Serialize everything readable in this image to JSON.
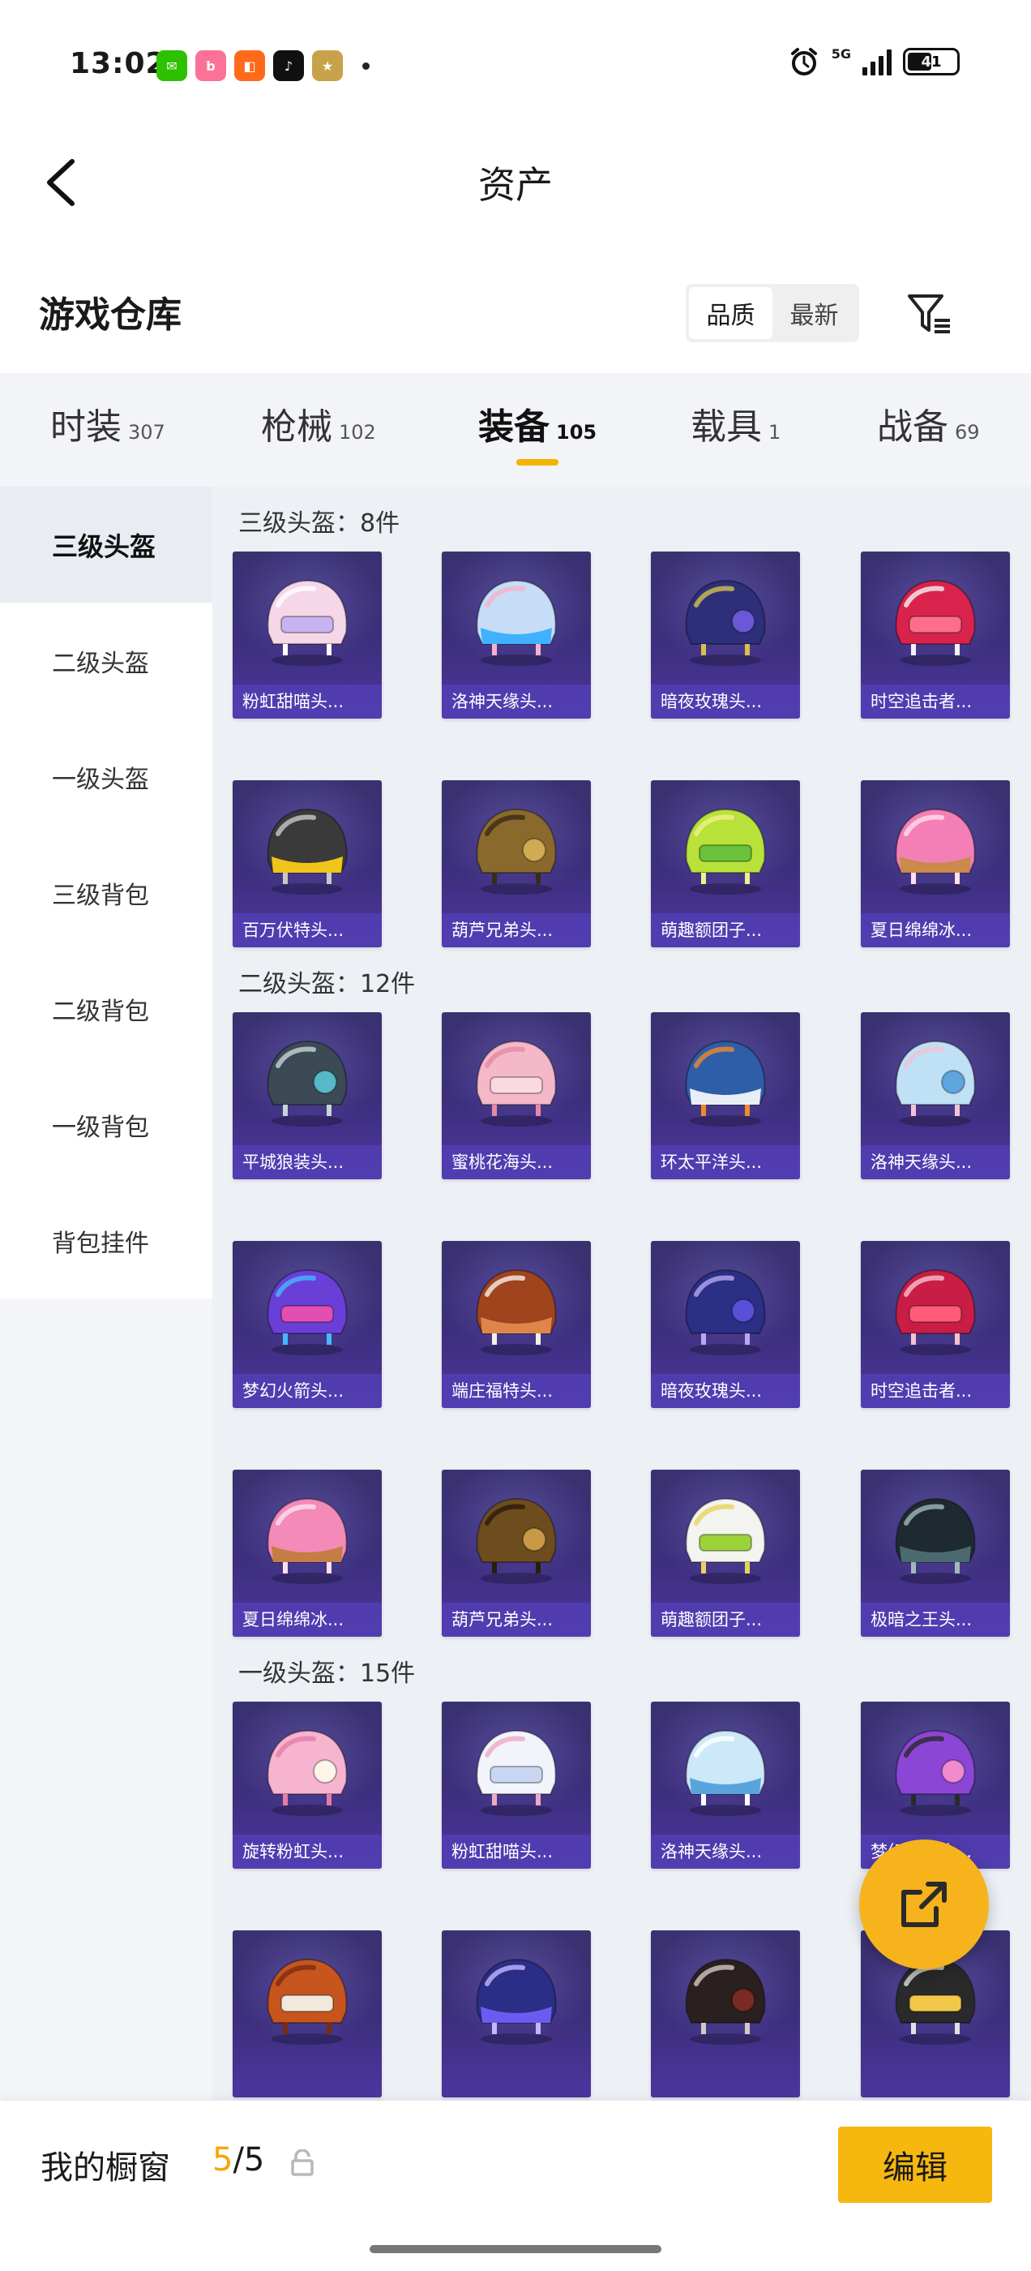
{
  "status": {
    "time": "13:02",
    "network": "5G",
    "battery": "41",
    "notification_icons": [
      {
        "name": "wechat-icon",
        "color": "#2dc100",
        "glyph": "✉"
      },
      {
        "name": "bilibili-icon",
        "color": "#fb7299",
        "glyph": "b"
      },
      {
        "name": "app-orange-icon",
        "color": "#ff6a1a",
        "glyph": "◧"
      },
      {
        "name": "tiktok-icon",
        "color": "#111111",
        "glyph": "♪"
      },
      {
        "name": "game-app-icon",
        "color": "#c8a24a",
        "glyph": "★"
      }
    ]
  },
  "header": {
    "title": "资产"
  },
  "warehouse": {
    "title": "游戏仓库",
    "sort_options": [
      "品质",
      "最新"
    ],
    "active_sort": 0
  },
  "tabs": [
    {
      "label": "时装",
      "count": "307"
    },
    {
      "label": "枪械",
      "count": "102"
    },
    {
      "label": "装备",
      "count": "105"
    },
    {
      "label": "载具",
      "count": "1"
    },
    {
      "label": "战备",
      "count": "69"
    }
  ],
  "active_tab": 2,
  "side_nav": [
    "三级头盔",
    "二级头盔",
    "一级头盔",
    "三级背包",
    "二级背包",
    "一级背包",
    "背包挂件"
  ],
  "active_side": 0,
  "sections": [
    {
      "header": "三级头盔：8件",
      "items": [
        {
          "name": "粉虹甜喵头...",
          "palette": [
            "#f6d7e8",
            "#c9b3f0",
            "#ffffff"
          ]
        },
        {
          "name": "洛神天缘头...",
          "palette": [
            "#c7ddf7",
            "#3fb1ff",
            "#f6b2c9"
          ]
        },
        {
          "name": "暗夜玫瑰头...",
          "palette": [
            "#2d2f7a",
            "#6a58d8",
            "#d6c14a"
          ]
        },
        {
          "name": "时空追击者...",
          "palette": [
            "#d9234d",
            "#ff6e89",
            "#f2f2f2"
          ]
        },
        {
          "name": "百万伏特头...",
          "palette": [
            "#3a3a3a",
            "#f0c419",
            "#c8c8c8"
          ]
        },
        {
          "name": "葫芦兄弟头...",
          "palette": [
            "#8a6a2c",
            "#d2aa55",
            "#3a2a14"
          ]
        },
        {
          "name": "萌趣额团子...",
          "palette": [
            "#b8e23a",
            "#69c23a",
            "#f0f08a"
          ]
        },
        {
          "name": "夏日绵绵冰...",
          "palette": [
            "#f47fb6",
            "#c98a4a",
            "#fde0ec"
          ]
        }
      ]
    },
    {
      "header": "二级头盔：12件",
      "items": [
        {
          "name": "平城狼装头...",
          "palette": [
            "#3b4a55",
            "#56b9c9",
            "#c9d3d8"
          ]
        },
        {
          "name": "蜜桃花海头...",
          "palette": [
            "#f5b8c8",
            "#fbd9e2",
            "#e48aa5"
          ]
        },
        {
          "name": "环太平洋头...",
          "palette": [
            "#2e5ea8",
            "#e8eef6",
            "#f08a2a"
          ]
        },
        {
          "name": "洛神天缘头...",
          "palette": [
            "#bfe0f5",
            "#5fa6e0",
            "#f2c2d6"
          ]
        },
        {
          "name": "梦幻火箭头...",
          "palette": [
            "#6a3fd8",
            "#e24fb0",
            "#46b7ff"
          ]
        },
        {
          "name": "端庄福特头...",
          "palette": [
            "#a0441e",
            "#e0854a",
            "#f5f0e6"
          ]
        },
        {
          "name": "暗夜玫瑰头...",
          "palette": [
            "#2b2f86",
            "#5a4fd8",
            "#b8a6f0"
          ]
        },
        {
          "name": "时空追击者...",
          "palette": [
            "#c81e46",
            "#ff5a7a",
            "#f5c1cf"
          ]
        },
        {
          "name": "夏日绵绵冰...",
          "palette": [
            "#f48ab8",
            "#c47d44",
            "#ffe0ee"
          ]
        },
        {
          "name": "葫芦兄弟头...",
          "palette": [
            "#6d4d1e",
            "#c99a45",
            "#2a1c0c"
          ]
        },
        {
          "name": "萌趣额团子...",
          "palette": [
            "#f3f3f0",
            "#9bd23a",
            "#e8d35a"
          ]
        },
        {
          "name": "极暗之王头...",
          "palette": [
            "#1e2a30",
            "#4a6a70",
            "#9fb8bc"
          ]
        }
      ]
    },
    {
      "header": "一级头盔：15件",
      "items": [
        {
          "name": "旋转粉虹头...",
          "palette": [
            "#f6b4cf",
            "#fff4ea",
            "#e77ca8"
          ]
        },
        {
          "name": "粉虹甜喵头...",
          "palette": [
            "#f1f4fb",
            "#c9d6f2",
            "#f1a8c4"
          ]
        },
        {
          "name": "洛神天缘头...",
          "palette": [
            "#cde8f8",
            "#5aa4de",
            "#ffffff"
          ]
        },
        {
          "name": "梦幻火箭头...",
          "palette": [
            "#8b46d6",
            "#f08bd0",
            "#2a2a2a"
          ]
        },
        {
          "name": "",
          "palette": [
            "#c6551e",
            "#f1e9dc",
            "#7a2c12"
          ]
        },
        {
          "name": "",
          "palette": [
            "#2a2e86",
            "#6a5cf0",
            "#c4b6ff"
          ]
        },
        {
          "name": "",
          "palette": [
            "#2a2020",
            "#7a2a24",
            "#d6c7c0"
          ]
        },
        {
          "name": "",
          "palette": [
            "#2a2a2a",
            "#f2c84a",
            "#e0e0e0"
          ]
        }
      ]
    }
  ],
  "bottom": {
    "showcase_label": "我的橱窗",
    "showcase_current": "5",
    "showcase_total": "/5",
    "edit_label": "编辑"
  },
  "colors": {
    "accent": "#f6b70f",
    "card_bg": "#3d2f7d",
    "card_label_bg": "#5a3fc0"
  }
}
